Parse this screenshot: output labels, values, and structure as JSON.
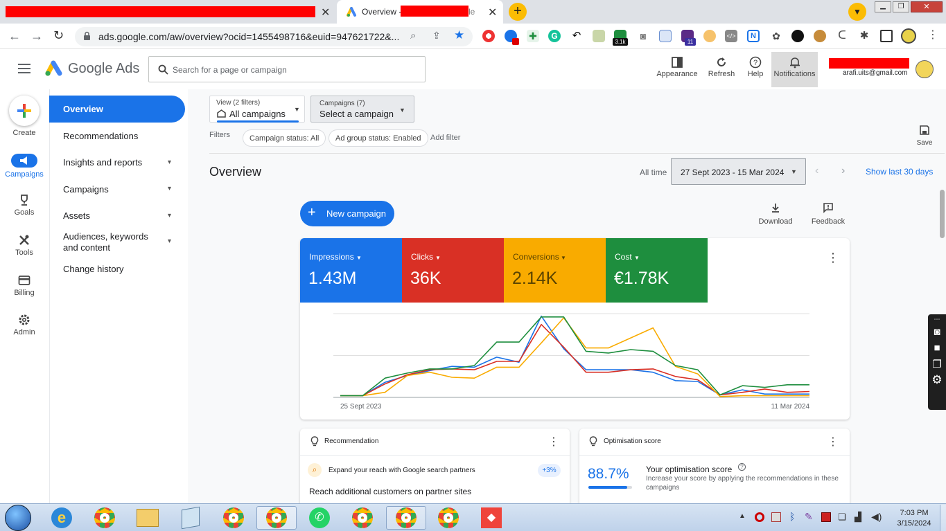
{
  "browser": {
    "tab_active_title_start": "Overview -",
    "tab_active_title_end": "le",
    "url": "ads.google.com/aw/overview?ocid=1455498716&euid=947621722&...",
    "extension_badge": "3.1k",
    "extension_badge2": "11"
  },
  "app": {
    "product_name": "Google Ads",
    "search_placeholder": "Search for a page or campaign",
    "header_buttons": [
      {
        "label": "Appearance"
      },
      {
        "label": "Refresh"
      },
      {
        "label": "Help"
      },
      {
        "label": "Notifications"
      }
    ],
    "account_email": "arafi.uits@gmail.com"
  },
  "rail": [
    {
      "label": "Create"
    },
    {
      "label": "Campaigns"
    },
    {
      "label": "Goals"
    },
    {
      "label": "Tools"
    },
    {
      "label": "Billing"
    },
    {
      "label": "Admin"
    }
  ],
  "nav": {
    "items": [
      {
        "label": "Overview"
      },
      {
        "label": "Recommendations"
      },
      {
        "label": "Insights and reports"
      },
      {
        "label": "Campaigns"
      },
      {
        "label": "Assets"
      },
      {
        "label": "Audiences, keywords and content"
      },
      {
        "label": "Change history"
      }
    ]
  },
  "toolbar": {
    "view_label": "View (2 filters)",
    "view_value": "All campaigns",
    "campaigns_label": "Campaigns (7)",
    "campaigns_value": "Select a campaign",
    "filters_label": "Filters",
    "filter_chips": [
      "Campaign status: All",
      "Ad group status: Enabled"
    ],
    "add_filter": "Add filter",
    "save": "Save"
  },
  "overview": {
    "title": "Overview",
    "range_label": "All time",
    "date_range": "27 Sept 2023 - 15 Mar 2024",
    "show_last": "Show last 30 days",
    "new_campaign": "New campaign",
    "download": "Download",
    "feedback": "Feedback"
  },
  "metrics": [
    {
      "label": "Impressions",
      "value": "1.43M",
      "color": "#1a73e8"
    },
    {
      "label": "Clicks",
      "value": "36K",
      "color": "#d93025"
    },
    {
      "label": "Conversions",
      "value": "2.14K",
      "color": "#f9ab00"
    },
    {
      "label": "Cost",
      "value": "€1.78K",
      "color": "#1e8e3e"
    }
  ],
  "chart_data": {
    "type": "line",
    "x_start_label": "25 Sept 2023",
    "x_end_label": "11 Mar 2024",
    "ylim": [
      0,
      1
    ],
    "grid": true,
    "series": [
      {
        "color": "#1a73e8",
        "values": [
          0.02,
          0.02,
          0.18,
          0.26,
          0.32,
          0.37,
          0.36,
          0.48,
          0.42,
          0.97,
          0.58,
          0.33,
          0.33,
          0.33,
          0.3,
          0.2,
          0.19,
          0.03,
          0.09,
          0.04,
          0.04,
          0.04
        ]
      },
      {
        "color": "#d93025",
        "values": [
          0.02,
          0.02,
          0.16,
          0.27,
          0.33,
          0.34,
          0.33,
          0.43,
          0.43,
          0.87,
          0.6,
          0.3,
          0.3,
          0.33,
          0.34,
          0.25,
          0.21,
          0.03,
          0.06,
          0.1,
          0.06,
          0.07
        ]
      },
      {
        "color": "#f9ab00",
        "values": [
          0.02,
          0.02,
          0.06,
          0.26,
          0.3,
          0.24,
          0.23,
          0.36,
          0.36,
          0.65,
          0.95,
          0.59,
          0.59,
          0.71,
          0.83,
          0.37,
          0.28,
          0.01,
          0.02,
          0.02,
          0.02,
          0.02
        ]
      },
      {
        "color": "#1e8e3e",
        "values": [
          0.02,
          0.02,
          0.23,
          0.29,
          0.34,
          0.34,
          0.38,
          0.66,
          0.66,
          0.96,
          0.96,
          0.55,
          0.53,
          0.57,
          0.55,
          0.38,
          0.33,
          0.03,
          0.14,
          0.12,
          0.15,
          0.15
        ]
      }
    ]
  },
  "recommendation_card": {
    "title": "Recommendation",
    "item": "Expand your reach with Google search partners",
    "badge": "+3%",
    "subtitle": "Reach additional customers on partner sites"
  },
  "optimisation_card": {
    "title": "Optimisation score",
    "score": "88.7%",
    "score_fraction": 0.887,
    "heading": "Your optimisation score",
    "desc": "Increase your score by applying the recommendations in these campaigns"
  },
  "taskbar": {
    "time": "7:03 PM",
    "date": "3/15/2024"
  }
}
